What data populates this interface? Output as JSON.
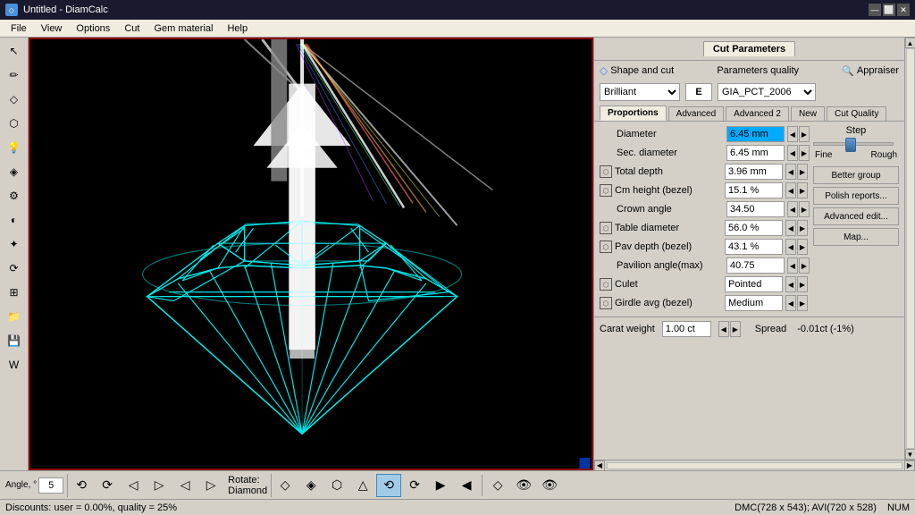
{
  "titleBar": {
    "title": "Untitled - DiamCalc",
    "icon": "◇",
    "buttons": [
      "⬜",
      "—",
      "✕"
    ]
  },
  "menuBar": {
    "items": [
      "File",
      "View",
      "Options",
      "Cut",
      "Gem material",
      "Help"
    ]
  },
  "leftToolbar": {
    "tools": [
      "↖",
      "✎",
      "◇",
      "⬡",
      "💡",
      "◈",
      "⚙",
      "◐",
      "✦",
      "⟲",
      "⊞",
      "📁",
      "💾",
      "W"
    ]
  },
  "rightPanel": {
    "tabLabel": "Cut Parameters",
    "shapeAndCut": "Shape and cut",
    "parametersQuality": "Parameters quality",
    "appraiser": "Appraiser",
    "brilliantValue": "Brilliant",
    "gradeValue": "E",
    "appraiserValue": "GIA_PCT_2006",
    "tabs": [
      "Proportions",
      "Advanced",
      "Advanced 2",
      "New",
      "Cut Quality"
    ],
    "stepLabel": "Step",
    "fineLabel": "Fine",
    "roughLabel": "Rough",
    "properties": [
      {
        "label": "Diameter",
        "value": "6.45 mm",
        "highlighted": true,
        "hasIcon": false
      },
      {
        "label": "Sec. diameter",
        "value": "6.45 mm",
        "highlighted": false,
        "hasIcon": false
      },
      {
        "label": "Total depth",
        "value": "3.96 mm",
        "highlighted": false,
        "hasIcon": true
      },
      {
        "label": "Cm height (bezel)",
        "value": "15.1 %",
        "highlighted": false,
        "hasIcon": true
      },
      {
        "label": "Crown angle",
        "value": "34.50",
        "highlighted": false,
        "hasIcon": false
      },
      {
        "label": "Table diameter",
        "value": "56.0 %",
        "highlighted": false,
        "hasIcon": true
      },
      {
        "label": "Pav depth (bezel)",
        "value": "43.1 %",
        "highlighted": false,
        "hasIcon": true
      },
      {
        "label": "Pavilion angle(max)",
        "value": "40.75",
        "highlighted": false,
        "hasIcon": false
      },
      {
        "label": "Culet",
        "value": "Pointed",
        "highlighted": false,
        "hasIcon": true
      },
      {
        "label": "Girdle avg (bezel)",
        "value": "Medium",
        "highlighted": false,
        "hasIcon": true
      }
    ],
    "actionButtons": [
      "Better group",
      "Polish reports...",
      "Advanced edit...",
      "Map..."
    ],
    "caratWeight": "1.00 ct",
    "caratLabel": "Carat weight",
    "spreadLabel": "Spread",
    "spreadValue": "-0.01ct (-1%)"
  },
  "bottomToolbar": {
    "angleLabel": "Angle, °",
    "angleValue": "5",
    "rotateLabel": "Rotate:",
    "rotateSublabel": "Diamond",
    "tools": [
      "⟲",
      "⟳",
      "◁▷",
      "◁▷",
      "◁▷",
      "◁▷",
      "◇",
      "◈",
      "⬡",
      "△",
      "⟲",
      "⟳",
      "▶",
      "◀",
      "◇",
      "👁",
      "👁"
    ]
  },
  "statusBar": {
    "left": "Discounts: user = 0.00%, quality = 25%",
    "right": "DMC(728 x 543); AVI(720 x 528)",
    "num": "NUM"
  }
}
